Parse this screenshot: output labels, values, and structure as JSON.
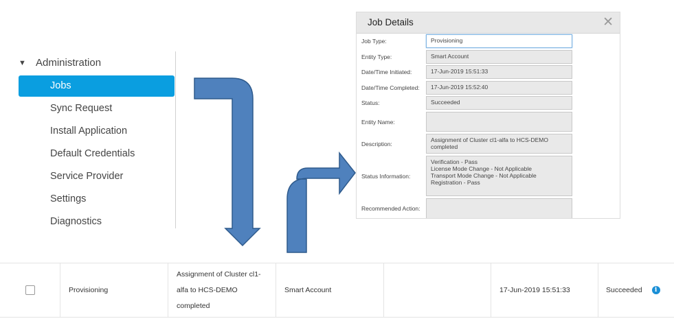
{
  "sidebar": {
    "section_caret": "▼",
    "section_title": "Administration",
    "items": [
      {
        "label": "Jobs",
        "active": true
      },
      {
        "label": "Sync Request"
      },
      {
        "label": "Install Application"
      },
      {
        "label": "Default Credentials"
      },
      {
        "label": "Service Provider"
      },
      {
        "label": "Settings"
      },
      {
        "label": "Diagnostics"
      }
    ]
  },
  "dialog": {
    "title": "Job Details",
    "close_glyph": "✕",
    "fields": {
      "job_type": {
        "label": "Job Type:",
        "value": "Provisioning"
      },
      "entity_type": {
        "label": "Entity Type:",
        "value": "Smart Account"
      },
      "date_initiated": {
        "label": "Date/Time Initiated:",
        "value": "17-Jun-2019 15:51:33"
      },
      "date_completed": {
        "label": "Date/Time Completed:",
        "value": "17-Jun-2019 15:52:40"
      },
      "status": {
        "label": "Status:",
        "value": "Succeeded"
      },
      "entity_name": {
        "label": "Entity Name:",
        "value": ""
      },
      "description": {
        "label": "Description:",
        "lines": [
          "Assignment of Cluster cl1-alfa to HCS-DEMO",
          "completed"
        ]
      },
      "status_info": {
        "label": "Status Information:",
        "lines": [
          "Verification - Pass",
          "License Mode Change - Not Applicable",
          "Transport Mode Change - Not Applicable",
          "Registration - Pass"
        ]
      },
      "recommended_action": {
        "label": "Recommended Action:",
        "value": ""
      }
    }
  },
  "table_row": {
    "job_type": "Provisioning",
    "description_lines": [
      "Assignment of Cluster cl1-",
      "alfa to HCS-DEMO",
      "completed"
    ],
    "entity_type": "Smart Account",
    "entity_name": "",
    "date": "17-Jun-2019 15:51:33",
    "status": "Succeeded",
    "info_glyph": "i"
  },
  "colors": {
    "active_nav": "#0a9ee0",
    "arrow_fill": "#4f81bd",
    "arrow_stroke": "#2e5a8c",
    "info_icon": "#1a8fd6"
  }
}
